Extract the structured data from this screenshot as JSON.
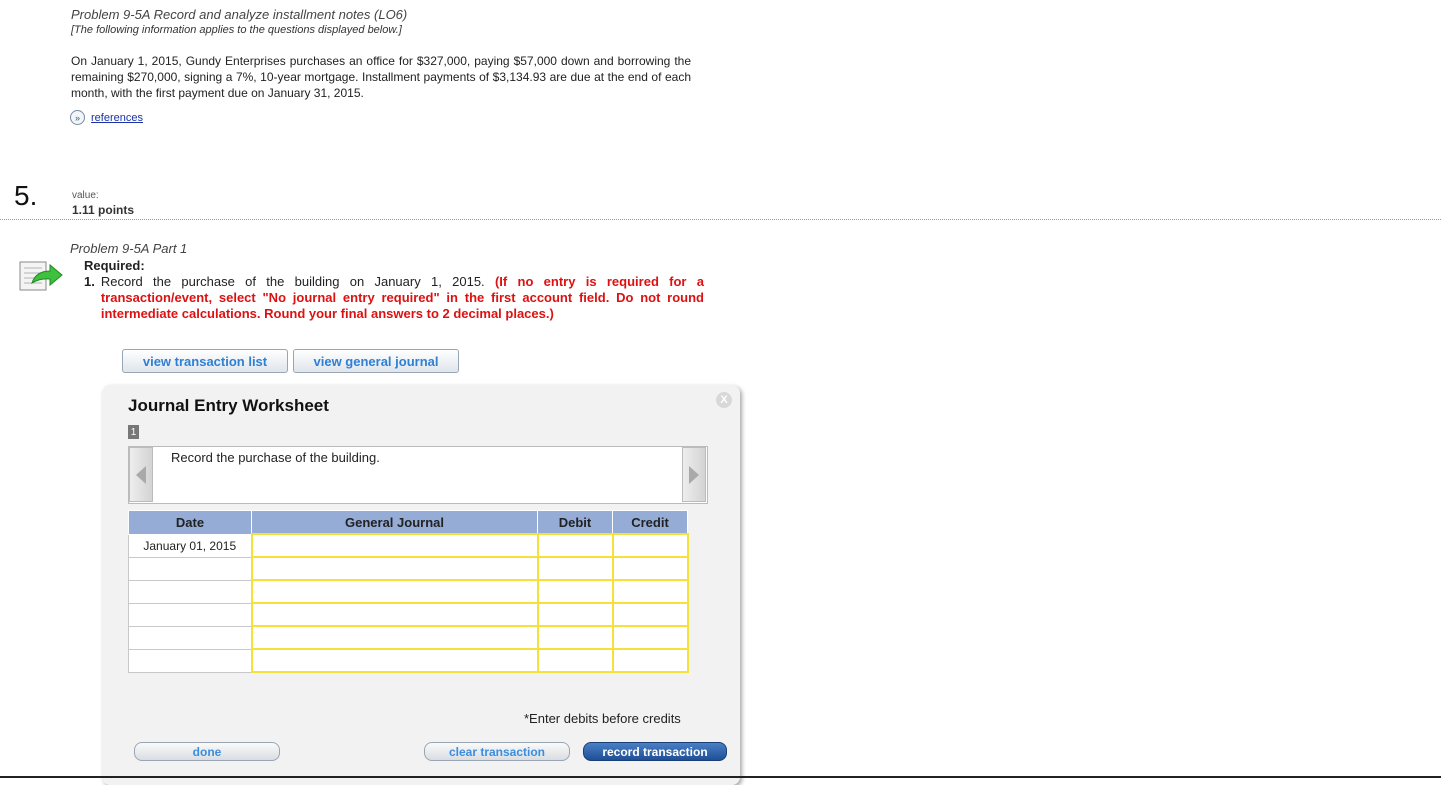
{
  "intro": {
    "title": "Problem 9-5A Record and analyze installment notes (LO6)",
    "note": "[The following information applies to the questions displayed below.]",
    "body": "On January 1, 2015, Gundy Enterprises purchases an office for $327,000, paying $57,000 down and borrowing the remaining $270,000, signing a 7%, 10-year mortgage. Installment payments of $3,134.93 are due at the end of each month, with the first payment due on January 31, 2015.",
    "references_label": "references",
    "references_icon": "»"
  },
  "question": {
    "number": "5.",
    "value_label": "value:",
    "points": "1.11 points"
  },
  "part": {
    "title": "Problem 9-5A Part 1",
    "required_label": "Required:",
    "instruction_number": "1.",
    "instruction_text": "Record the purchase of the building on January 1, 2015. ",
    "instruction_red": "(If no entry is required for a transaction/event, select \"No journal entry required\" in the first account field. Do not round intermediate calculations. Round your final answers to 2 decimal places.)"
  },
  "toolbar": {
    "view_transaction_list": "view transaction list",
    "view_general_journal": "view general journal"
  },
  "worksheet": {
    "title": "Journal Entry Worksheet",
    "close_label": "X",
    "step_number": "1",
    "description": "Record the purchase of the building.",
    "columns": [
      "Date",
      "General Journal",
      "Debit",
      "Credit"
    ],
    "rows": [
      {
        "date": "January 01, 2015"
      },
      {
        "date": ""
      },
      {
        "date": ""
      },
      {
        "date": ""
      },
      {
        "date": ""
      },
      {
        "date": ""
      }
    ],
    "note": "*Enter debits before credits",
    "done_label": "done",
    "clear_label": "clear transaction",
    "record_label": "record transaction"
  }
}
